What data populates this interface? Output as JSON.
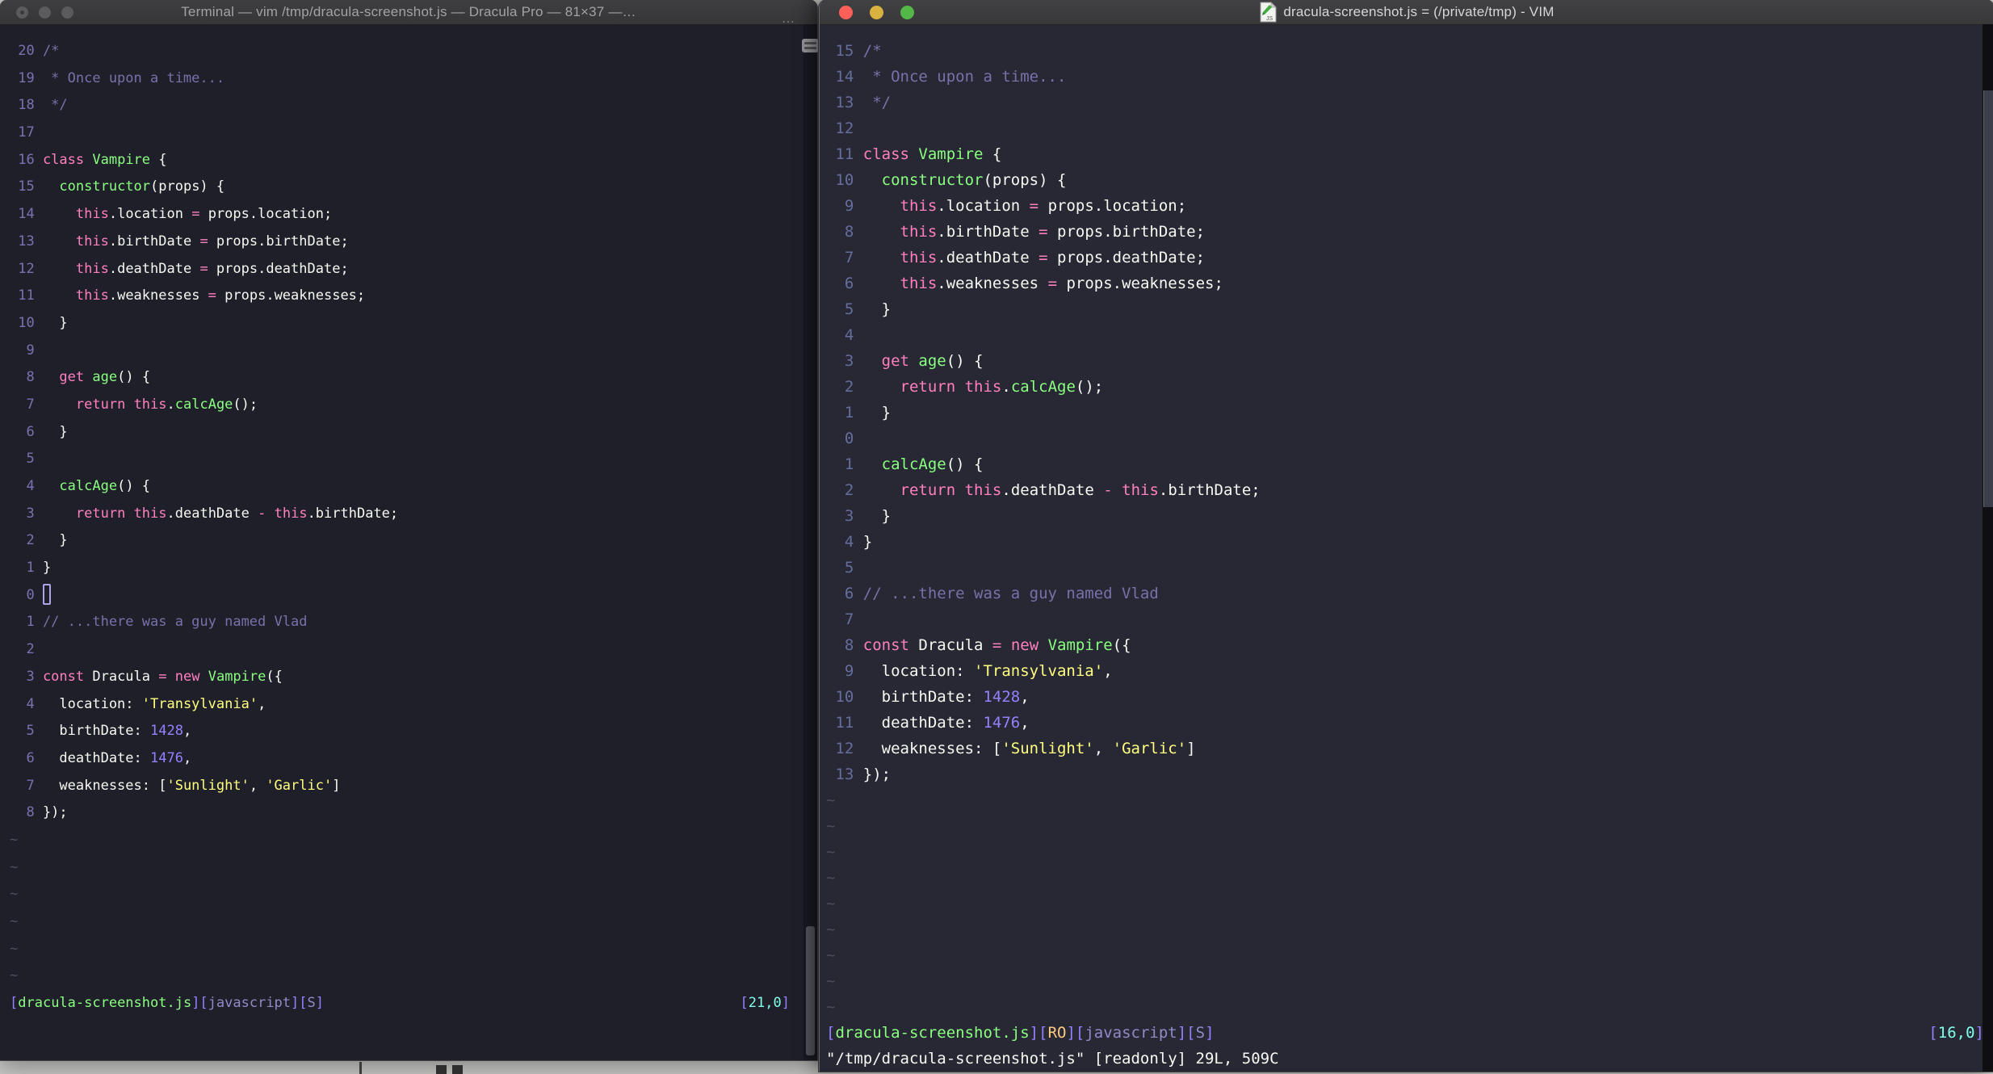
{
  "colors": {
    "tokens": {
      "fg": "#F8F8F2",
      "cm": "#7970A9",
      "pk": "#FF80BF",
      "gr": "#8AFF80",
      "yl": "#FFFF80",
      "pu": "#9580FF",
      "cy": "#80FFEA",
      "or": "#FFCA80",
      "lv": "#8F8BC7"
    },
    "ui": {
      "bg_left": "#1F1F2A",
      "bg_right": "#272834",
      "num_left": "#7A72B0",
      "num_right": "#656E9C",
      "tilde": "#4E4D5C",
      "cursor": "#ACA4E8",
      "traffic_red": "#FC6058",
      "traffic_yellow": "#D9B13F",
      "traffic_green": "#53B847",
      "traffic_gray": "#5B5B5E"
    }
  },
  "code_lines": [
    [
      [
        "cm",
        "/*"
      ]
    ],
    [
      [
        "cm",
        " * Once upon a time..."
      ]
    ],
    [
      [
        "cm",
        " */"
      ]
    ],
    [],
    [
      [
        "pk",
        "class"
      ],
      [
        "fg",
        " "
      ],
      [
        "gr",
        "Vampire"
      ],
      [
        "fg",
        " {"
      ]
    ],
    [
      [
        "fg",
        "  "
      ],
      [
        "gr",
        "constructor"
      ],
      [
        "fg",
        "(props) {"
      ]
    ],
    [
      [
        "fg",
        "    "
      ],
      [
        "pk",
        "this"
      ],
      [
        "fg",
        ".location "
      ],
      [
        "pk",
        "="
      ],
      [
        "fg",
        " props.location;"
      ]
    ],
    [
      [
        "fg",
        "    "
      ],
      [
        "pk",
        "this"
      ],
      [
        "fg",
        ".birthDate "
      ],
      [
        "pk",
        "="
      ],
      [
        "fg",
        " props.birthDate;"
      ]
    ],
    [
      [
        "fg",
        "    "
      ],
      [
        "pk",
        "this"
      ],
      [
        "fg",
        ".deathDate "
      ],
      [
        "pk",
        "="
      ],
      [
        "fg",
        " props.deathDate;"
      ]
    ],
    [
      [
        "fg",
        "    "
      ],
      [
        "pk",
        "this"
      ],
      [
        "fg",
        ".weaknesses "
      ],
      [
        "pk",
        "="
      ],
      [
        "fg",
        " props.weaknesses;"
      ]
    ],
    [
      [
        "fg",
        "  }"
      ]
    ],
    [],
    [
      [
        "fg",
        "  "
      ],
      [
        "pk",
        "get"
      ],
      [
        "fg",
        " "
      ],
      [
        "gr",
        "age"
      ],
      [
        "fg",
        "() {"
      ]
    ],
    [
      [
        "fg",
        "    "
      ],
      [
        "pk",
        "return"
      ],
      [
        "fg",
        " "
      ],
      [
        "pk",
        "this"
      ],
      [
        "fg",
        "."
      ],
      [
        "gr",
        "calcAge"
      ],
      [
        "fg",
        "();"
      ]
    ],
    [
      [
        "fg",
        "  }"
      ]
    ],
    [],
    [
      [
        "fg",
        "  "
      ],
      [
        "gr",
        "calcAge"
      ],
      [
        "fg",
        "() {"
      ]
    ],
    [
      [
        "fg",
        "    "
      ],
      [
        "pk",
        "return"
      ],
      [
        "fg",
        " "
      ],
      [
        "pk",
        "this"
      ],
      [
        "fg",
        ".deathDate "
      ],
      [
        "pk",
        "-"
      ],
      [
        "fg",
        " "
      ],
      [
        "pk",
        "this"
      ],
      [
        "fg",
        ".birthDate;"
      ]
    ],
    [
      [
        "fg",
        "  }"
      ]
    ],
    [
      [
        "fg",
        "}"
      ]
    ],
    [],
    [
      [
        "cm",
        "// ...there was a guy named Vlad"
      ]
    ],
    [],
    [
      [
        "pk",
        "const"
      ],
      [
        "fg",
        " Dracula "
      ],
      [
        "pk",
        "="
      ],
      [
        "fg",
        " "
      ],
      [
        "pk",
        "new"
      ],
      [
        "fg",
        " "
      ],
      [
        "gr",
        "Vampire"
      ],
      [
        "fg",
        "({"
      ]
    ],
    [
      [
        "fg",
        "  location: "
      ],
      [
        "yl",
        "'Transylvania'"
      ],
      [
        "fg",
        ","
      ]
    ],
    [
      [
        "fg",
        "  birthDate: "
      ],
      [
        "pu",
        "1428"
      ],
      [
        "fg",
        ","
      ]
    ],
    [
      [
        "fg",
        "  deathDate: "
      ],
      [
        "pu",
        "1476"
      ],
      [
        "fg",
        ","
      ]
    ],
    [
      [
        "fg",
        "  weaknesses: ["
      ],
      [
        "yl",
        "'Sunlight'"
      ],
      [
        "fg",
        ", "
      ],
      [
        "yl",
        "'Garlic'"
      ],
      [
        "fg",
        "]"
      ]
    ],
    [
      [
        "fg",
        "});"
      ]
    ]
  ],
  "left": {
    "title": "Terminal — vim /tmp/dracula-screenshot.js — Dracula Pro — 81×37 —…",
    "overflow_dots": "⋯",
    "rel_numbers": [
      "20",
      "19",
      "18",
      "17",
      "16",
      "15",
      "14",
      "13",
      "12",
      "11",
      "10",
      "9",
      "8",
      "7",
      "6",
      "5",
      "4",
      "3",
      "2",
      "1",
      "0",
      "1",
      "2",
      "3",
      "4",
      "5",
      "6",
      "7",
      "8"
    ],
    "cursor_row": 20,
    "tilde_count": 6,
    "status_tokens": [
      [
        "pu",
        "["
      ],
      [
        "gr",
        "dracula-screenshot.js"
      ],
      [
        "pu",
        "]["
      ],
      [
        "lv",
        "javascript"
      ],
      [
        "pu",
        "]["
      ],
      [
        "lv",
        "S"
      ],
      [
        "pu",
        "]"
      ]
    ],
    "cursor_pos_tokens": [
      [
        "pu",
        "["
      ],
      [
        "cy",
        "21,0"
      ],
      [
        "pu",
        "]"
      ]
    ],
    "command_tokens": []
  },
  "right": {
    "title": "dracula-screenshot.js = (/private/tmp) - VIM",
    "rel_numbers": [
      "15",
      "14",
      "13",
      "12",
      "11",
      "10",
      "9",
      "8",
      "7",
      "6",
      "5",
      "4",
      "3",
      "2",
      "1",
      "0",
      "1",
      "2",
      "3",
      "4",
      "5",
      "6",
      "7",
      "8",
      "9",
      "10",
      "11",
      "12",
      "13"
    ],
    "cursor_row": null,
    "tilde_count": 9,
    "status_tokens": [
      [
        "pu",
        "["
      ],
      [
        "gr",
        "dracula-screenshot.js"
      ],
      [
        "pu",
        "]["
      ],
      [
        "or",
        "RO"
      ],
      [
        "pu",
        "]["
      ],
      [
        "lv",
        "javascript"
      ],
      [
        "pu",
        "]["
      ],
      [
        "lv",
        "S"
      ],
      [
        "pu",
        "]"
      ]
    ],
    "cursor_pos_tokens": [
      [
        "pu",
        "["
      ],
      [
        "cy",
        "16,0"
      ],
      [
        "pu",
        "]"
      ]
    ],
    "command_tokens": [
      [
        "fg",
        "\"/tmp/dracula-screenshot.js\" [readonly] 29L, 509C"
      ]
    ]
  }
}
